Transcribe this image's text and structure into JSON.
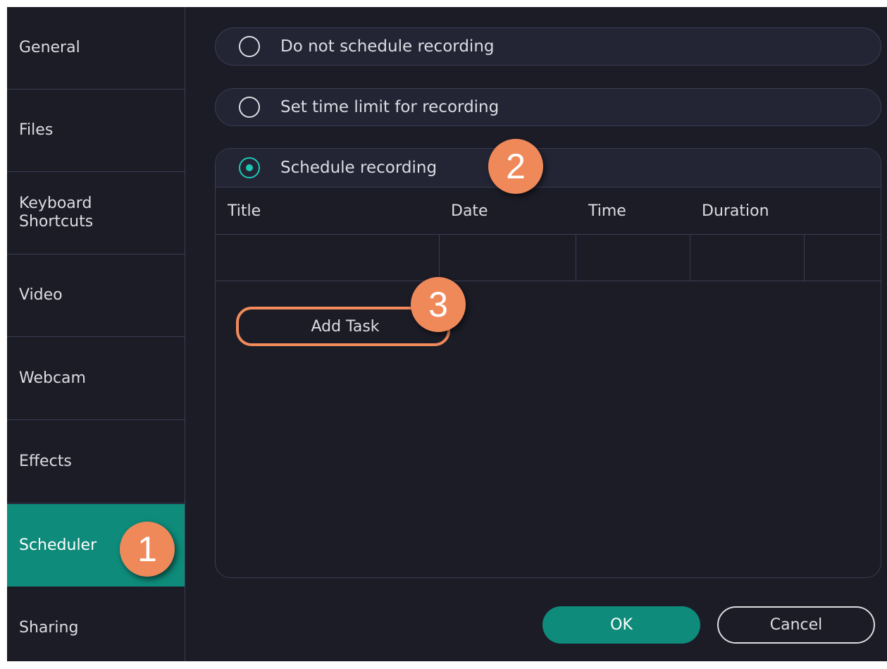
{
  "sidebar": {
    "items": [
      {
        "label": "General"
      },
      {
        "label": "Files"
      },
      {
        "label": "Keyboard\nShortcuts"
      },
      {
        "label": "Video"
      },
      {
        "label": "Webcam"
      },
      {
        "label": "Effects"
      },
      {
        "label": "Scheduler",
        "active": true
      },
      {
        "label": "Sharing"
      }
    ]
  },
  "options": {
    "no_schedule": "Do not schedule recording",
    "time_limit": "Set time limit for recording",
    "schedule": "Schedule recording",
    "selected": "schedule"
  },
  "table": {
    "columns": [
      "Title",
      "Date",
      "Time",
      "Duration"
    ]
  },
  "actions": {
    "add_task": "Add Task",
    "ok": "OK",
    "cancel": "Cancel"
  },
  "callouts": [
    "1",
    "2",
    "3"
  ],
  "colors": {
    "accent": "#0e8b7a",
    "radio_checked": "#1ec6b4",
    "callout": "#f0895a"
  }
}
